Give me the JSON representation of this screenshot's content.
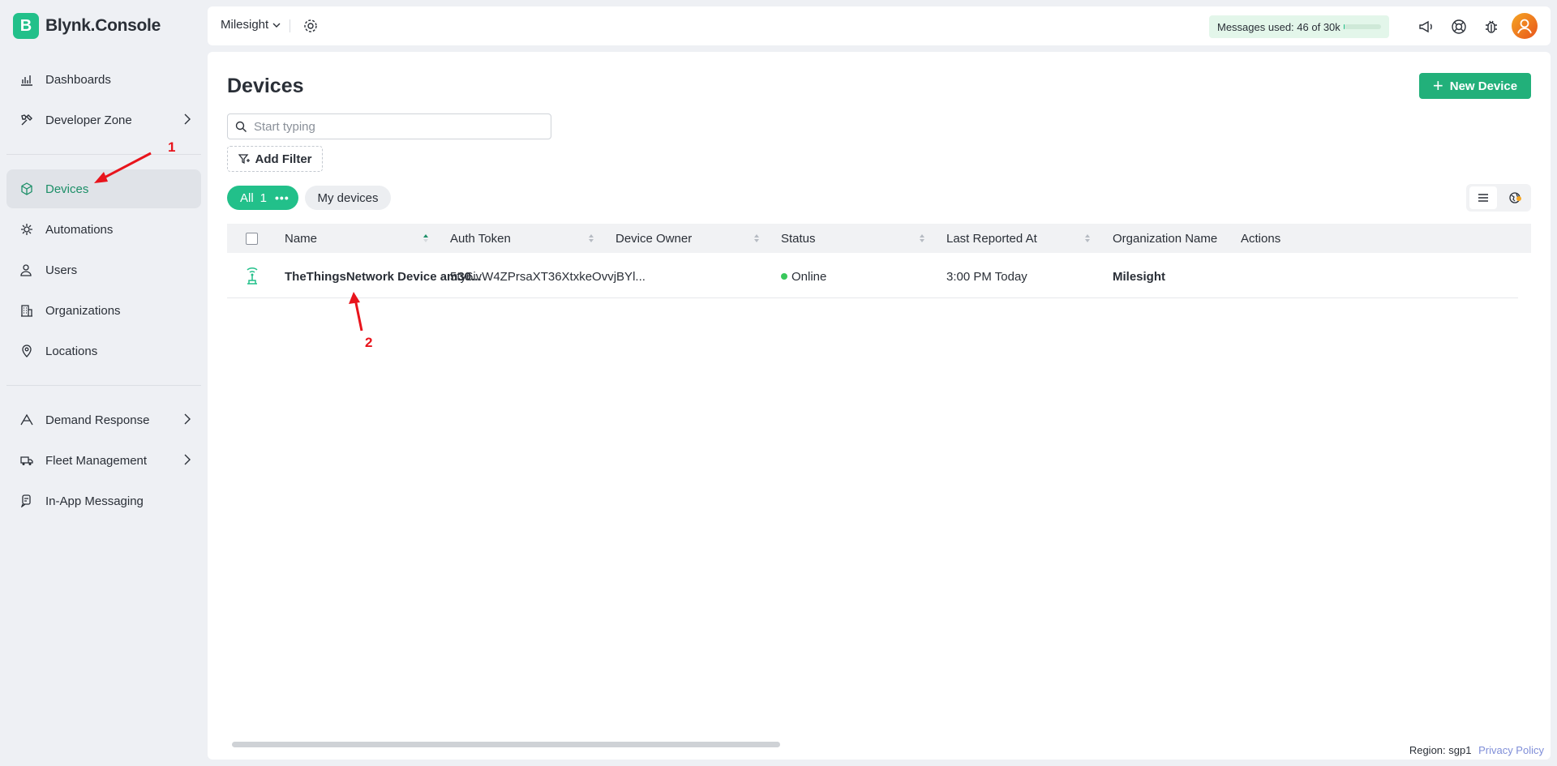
{
  "brand": {
    "logo_letter": "B",
    "name": "Blynk.Console"
  },
  "sidebar": {
    "items": [
      {
        "label": "Dashboards",
        "icon": "dashboard-chart-icon"
      },
      {
        "label": "Developer Zone",
        "icon": "tools-icon"
      },
      {
        "label": "Devices",
        "icon": "cube-icon"
      },
      {
        "label": "Automations",
        "icon": "automation-icon"
      },
      {
        "label": "Users",
        "icon": "users-icon"
      },
      {
        "label": "Organizations",
        "icon": "building-icon"
      },
      {
        "label": "Locations",
        "icon": "location-pin-icon"
      },
      {
        "label": "Demand Response",
        "icon": "demand-icon"
      },
      {
        "label": "Fleet Management",
        "icon": "truck-icon"
      },
      {
        "label": "In-App Messaging",
        "icon": "messaging-icon"
      }
    ],
    "active": "Devices"
  },
  "annotations": {
    "first": "1",
    "second": "2",
    "color": "#e8141c"
  },
  "topbar": {
    "org": "Milesight",
    "messages_label": "Messages used:",
    "messages_value": "46 of 30k",
    "messages_used_fraction": 0.0015
  },
  "main": {
    "title": "Devices",
    "new_device_label": "New Device",
    "search_placeholder": "Start typing",
    "add_filter_label": "Add Filter",
    "filter_all_label": "All",
    "filter_all_count": "1",
    "filter_my_label": "My devices"
  },
  "table": {
    "columns": [
      "Name",
      "Auth Token",
      "Device Owner",
      "Status",
      "Last Reported At",
      "Organization Name",
      "Actions"
    ],
    "rows": [
      {
        "name": "TheThingsNetwork Device am30...",
        "auth_token": "5ty6ivW4ZPrsaXT36XtxkeOvvjBYl...",
        "owner": "",
        "status": "Online",
        "last_reported": "3:00 PM Today",
        "organization": "Milesight",
        "actions": ""
      }
    ]
  },
  "footer": {
    "region": "Region: sgp1",
    "privacy": "Privacy Policy"
  },
  "colors": {
    "accent": "#22c08a",
    "button": "#22b07a",
    "online": "#39c85c",
    "link": "#7f8ed8"
  }
}
